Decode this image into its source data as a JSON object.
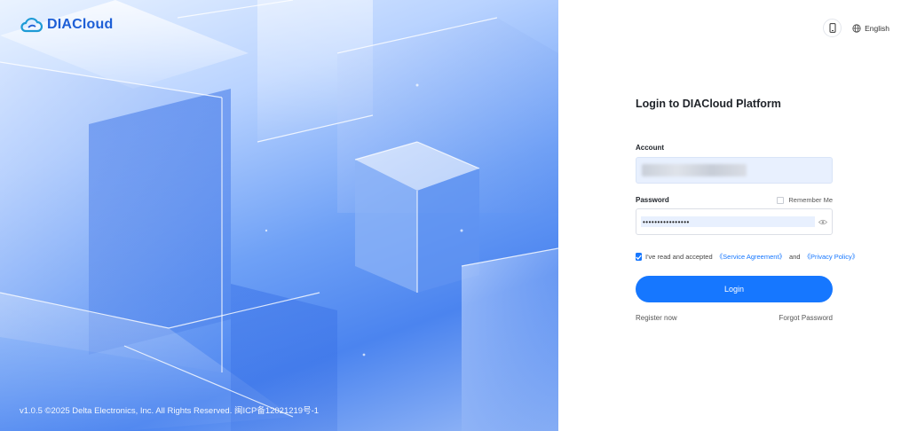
{
  "brand": {
    "name": "DIACloud",
    "logo_icon": "cloud-logo-icon",
    "accent": "#1e5fd6"
  },
  "footer": {
    "copyright": "v1.0.5 ©2025 Delta Electronics, Inc. All Rights Reserved. 闽ICP备12021219号-1"
  },
  "header": {
    "mobile_icon": "mobile-phone-icon",
    "language_icon": "globe-icon",
    "language_label": "English"
  },
  "login": {
    "title": "Login to DIACloud Platform",
    "account_label": "Account",
    "account_value": "",
    "password_label": "Password",
    "remember_label": "Remember Me",
    "password_value": "••••••••••••••••",
    "password_toggle_icon": "eye-icon",
    "agreement_prefix": "I've read and accepted",
    "service_agreement": "《Service Agreement》",
    "agreement_and": "and",
    "privacy_policy": "《Privacy Policy》",
    "agreement_checked": true,
    "login_button": "Login",
    "register_link": "Register now",
    "forgot_link": "Forgot Password",
    "button_color": "#1677ff"
  }
}
